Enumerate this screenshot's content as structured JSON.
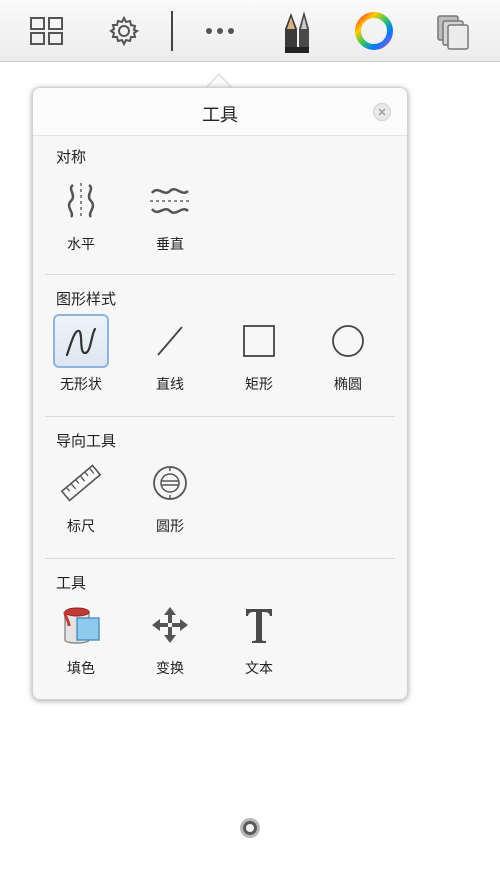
{
  "toolbar": {
    "items": [
      {
        "name": "layout-grid-icon"
      },
      {
        "name": "gear-icon"
      },
      {
        "name": "more-icon"
      },
      {
        "name": "brush-icon"
      },
      {
        "name": "color-wheel-icon"
      },
      {
        "name": "layers-icon"
      }
    ]
  },
  "popover": {
    "title": "工具",
    "sections": [
      {
        "title": "对称",
        "items": [
          {
            "label": "水平",
            "icon": "symmetry-horizontal-icon"
          },
          {
            "label": "垂直",
            "icon": "symmetry-vertical-icon"
          }
        ]
      },
      {
        "title": "图形样式",
        "items": [
          {
            "label": "无形状",
            "icon": "freeform-icon",
            "selected": true
          },
          {
            "label": "直线",
            "icon": "line-icon"
          },
          {
            "label": "矩形",
            "icon": "rectangle-icon"
          },
          {
            "label": "椭圆",
            "icon": "ellipse-icon"
          }
        ]
      },
      {
        "title": "导向工具",
        "items": [
          {
            "label": "标尺",
            "icon": "ruler-icon"
          },
          {
            "label": "圆形",
            "icon": "circle-guide-icon"
          }
        ]
      },
      {
        "title": "工具",
        "items": [
          {
            "label": "填色",
            "icon": "fill-icon"
          },
          {
            "label": "变换",
            "icon": "transform-icon"
          },
          {
            "label": "文本",
            "icon": "text-icon"
          }
        ]
      }
    ]
  },
  "colors": {
    "selected_border": "#8fb3dd",
    "fill_blue": "#8ec9ee",
    "fill_red": "#c23a36"
  }
}
